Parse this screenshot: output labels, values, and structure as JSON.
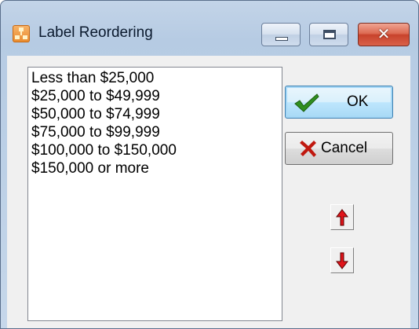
{
  "window": {
    "title": "Label Reordering",
    "icon": "app-hierarchy-icon",
    "controls": {
      "minimize_icon": "minimize-icon",
      "maximize_icon": "maximize-icon",
      "close_icon": "close-icon",
      "close_glyph": "✕"
    }
  },
  "list": {
    "items": [
      "Less than $25,000",
      "$25,000 to $49,999",
      "$50,000 to $74,999",
      "$75,000 to $99,999",
      "$100,000 to $150,000",
      "$150,000 or more"
    ]
  },
  "buttons": {
    "ok_label": "OK",
    "cancel_label": "Cancel",
    "ok_icon": "checkmark-icon",
    "cancel_icon": "x-mark-icon",
    "move_up_icon": "arrow-up-icon",
    "move_down_icon": "arrow-down-icon"
  },
  "colors": {
    "ok_check": "#2f8f1f",
    "cancel_x": "#c0180f",
    "arrow_red": "#e0141a"
  }
}
